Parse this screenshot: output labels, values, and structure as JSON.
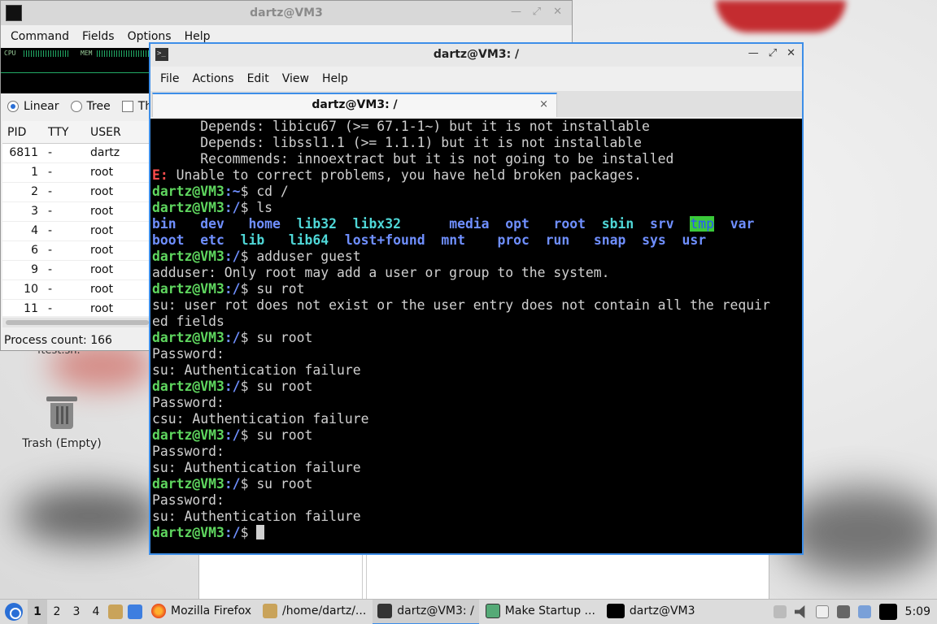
{
  "taskmanager": {
    "title": "dartz@VM3",
    "menu": [
      "Command",
      "Fields",
      "Options",
      "Help"
    ],
    "graph": {
      "cpu_label": "CPU",
      "mem_label": "MEM"
    },
    "view": {
      "linear": "Linear",
      "tree": "Tree",
      "third": "Th"
    },
    "columns": {
      "pid": "PID",
      "tty": "TTY",
      "user": "USER"
    },
    "rows": [
      {
        "pid": "6811",
        "tty": "-",
        "user": "dartz"
      },
      {
        "pid": "1",
        "tty": "-",
        "user": "root"
      },
      {
        "pid": "2",
        "tty": "-",
        "user": "root"
      },
      {
        "pid": "3",
        "tty": "-",
        "user": "root"
      },
      {
        "pid": "4",
        "tty": "-",
        "user": "root"
      },
      {
        "pid": "6",
        "tty": "-",
        "user": "root"
      },
      {
        "pid": "9",
        "tty": "-",
        "user": "root"
      },
      {
        "pid": "10",
        "tty": "-",
        "user": "root"
      },
      {
        "pid": "11",
        "tty": "-",
        "user": "root"
      }
    ],
    "status": "Process count: 166"
  },
  "desktop": {
    "trash_label": "Trash (Empty)",
    "partial_label": "ftest.sh."
  },
  "terminal": {
    "title": "dartz@VM3: /",
    "menu": [
      "File",
      "Actions",
      "Edit",
      "View",
      "Help"
    ],
    "tab_label": "dartz@VM3: /",
    "tab_close": "×",
    "lines": {
      "l1": "      Depends: libicu67 (>= 67.1-1~) but it is not installable",
      "l2": "      Depends: libssl1.1 (>= 1.1.1) but it is not installable",
      "l3": "      Recommends: innoextract but it is not going to be installed",
      "l4_err": "E:",
      "l4_rest": " Unable to correct problems, you have held broken packages.",
      "prompt_user": "dartz@VM3",
      "home_path": ":~",
      "root_path": ":/",
      "dollar": "$ ",
      "cmd_cd": "cd /",
      "cmd_ls": "ls",
      "ls_row1": [
        "bin",
        "dev",
        "home",
        "lib32",
        "libx32",
        "media",
        "opt",
        "root",
        "sbin",
        "srv",
        "tmp",
        "var"
      ],
      "ls_row2": [
        "boot",
        "etc",
        "lib",
        "lib64",
        "lost+found",
        "mnt",
        "proc",
        "run",
        "snap",
        "sys",
        "usr"
      ],
      "cmd_adduser": "adduser guest",
      "out_adduser": "adduser: Only root may add a user or group to the system.",
      "cmd_surot": "su rot",
      "out_surot1": "su: user rot does not exist or the user entry does not contain all the requir",
      "out_surot2": "ed fields",
      "cmd_suroot": "su root",
      "password": "Password:",
      "auth_fail": "su: Authentication failure",
      "auth_fail_c": "csu: Authentication failure"
    }
  },
  "taskbar": {
    "workspaces": [
      "1",
      "2",
      "3",
      "4"
    ],
    "tasks": [
      {
        "label": "Mozilla Firefox",
        "icon": "firefox-icon"
      },
      {
        "label": "/home/dartz/...",
        "icon": "folder-icon"
      },
      {
        "label": "dartz@VM3: /",
        "icon": "terminal-icon"
      },
      {
        "label": "Make Startup ...",
        "icon": "installer-icon"
      },
      {
        "label": "dartz@VM3",
        "icon": "taskmanager-icon"
      }
    ],
    "clock": "5:09"
  }
}
